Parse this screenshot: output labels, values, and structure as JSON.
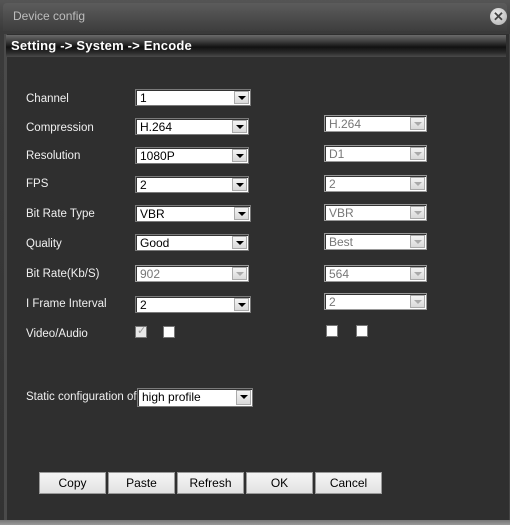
{
  "window": {
    "title": "Device config",
    "close_icon": "close-icon"
  },
  "breadcrumb": "Setting -> System -> Encode",
  "fields": {
    "channel": {
      "label": "Channel",
      "main": "1"
    },
    "compression": {
      "label": "Compression",
      "main": "H.264",
      "extra": "H.264"
    },
    "resolution": {
      "label": "Resolution",
      "main": "1080P",
      "extra": "D1"
    },
    "fps": {
      "label": "FPS",
      "main": "2",
      "extra": "2"
    },
    "bitrate_type": {
      "label": "Bit Rate Type",
      "main": "VBR",
      "extra": "VBR"
    },
    "quality": {
      "label": "Quality",
      "main": "Good",
      "extra": "Best"
    },
    "bitrate": {
      "label": "Bit Rate(Kb/S)",
      "main": "902",
      "extra": "564"
    },
    "iframe": {
      "label": "I Frame Interval",
      "main": "2",
      "extra": "2"
    },
    "video_audio": {
      "label": "Video/Audio",
      "main_video": true,
      "main_audio": false,
      "extra_video": false,
      "extra_audio": false
    }
  },
  "static_config": {
    "label": "Static configuration of",
    "value": "high profile"
  },
  "buttons": {
    "copy": "Copy",
    "paste": "Paste",
    "refresh": "Refresh",
    "ok": "OK",
    "cancel": "Cancel"
  }
}
